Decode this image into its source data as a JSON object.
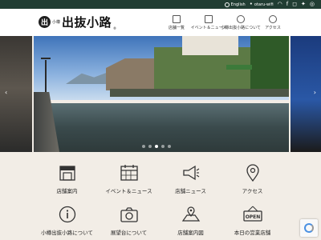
{
  "topbar": {
    "language_label": "English",
    "wifi_label": "otaru-wifi",
    "social_icons": [
      "wifi-icon",
      "facebook-icon",
      "instagram-icon",
      "twitter-icon",
      "tripadvisor-icon"
    ]
  },
  "header": {
    "logo_mark": "出",
    "logo_small": "小樽",
    "logo_text": "出抜小路",
    "logo_reg": "®",
    "nav": [
      {
        "label": "店舗一覧",
        "icon": "store-icon"
      },
      {
        "label": "イベント＆ニュース",
        "icon": "calendar-icon"
      },
      {
        "label": "小樽出抜小路について",
        "icon": "info-icon"
      },
      {
        "label": "アクセス",
        "icon": "map-pin-icon"
      }
    ]
  },
  "hero": {
    "slide_count": 5,
    "active_slide": 3
  },
  "menu": [
    {
      "label": "店舗案内",
      "icon": "store-icon"
    },
    {
      "label": "イベント＆ニュース",
      "icon": "calendar-icon"
    },
    {
      "label": "店舗ニュース",
      "icon": "megaphone-icon"
    },
    {
      "label": "アクセス",
      "icon": "map-pin-icon"
    },
    {
      "label": "小樽出抜小路について",
      "icon": "info-icon"
    },
    {
      "label": "展望台について",
      "icon": "camera-icon"
    },
    {
      "label": "店舗案内図",
      "icon": "map-icon"
    },
    {
      "label": "本日の営業店舗",
      "icon": "open-sign-icon"
    }
  ],
  "colors": {
    "topbar_bg": "#213d33",
    "page_bg": "#f2ede6"
  }
}
